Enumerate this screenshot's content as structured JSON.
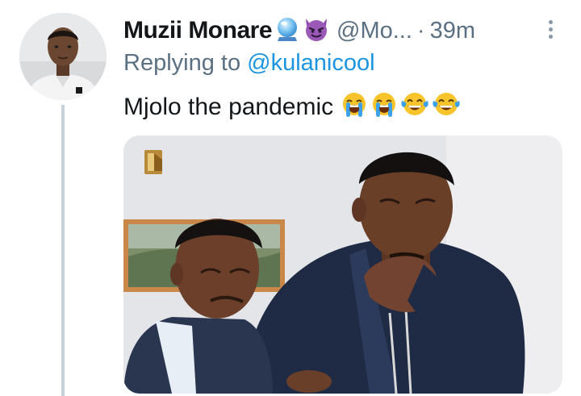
{
  "tweet": {
    "display_name": "Muzii Monare",
    "handle": "@Mo...",
    "separator": "·",
    "timestamp": "39m",
    "replying_prefix": "Replying to ",
    "replying_to": "@kulanicool",
    "text": "Mjolo the pandemic",
    "name_emojis": [
      "crystal-ball-icon",
      "smiling-devil-icon"
    ],
    "text_emojis": [
      "loudly-crying-face-icon",
      "loudly-crying-face-icon",
      "tears-of-joy-face-icon",
      "tears-of-joy-face-icon"
    ]
  },
  "colors": {
    "name": "#14171a",
    "secondary": "#5b7083",
    "link": "#1b95e0",
    "thread_line": "#c9d1d8"
  }
}
